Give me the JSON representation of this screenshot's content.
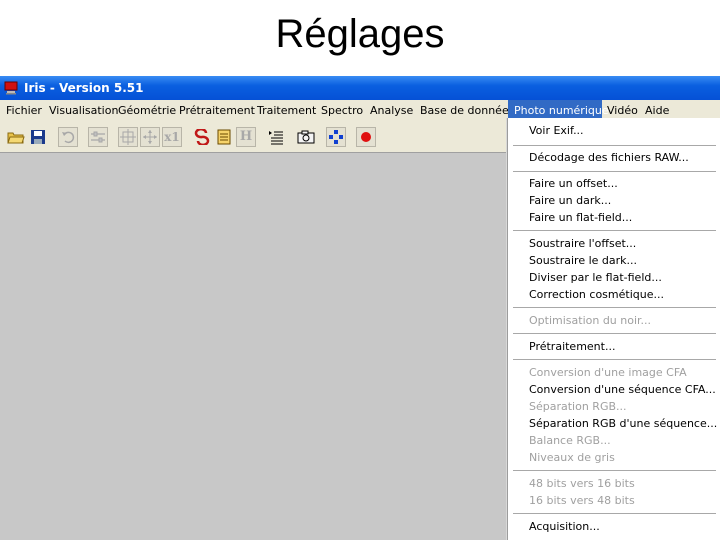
{
  "slide": {
    "title": "Réglages"
  },
  "window": {
    "title": "Iris - Version 5.51",
    "menu": [
      {
        "label": "Fichier",
        "active": false
      },
      {
        "label": "Visualisation",
        "active": false
      },
      {
        "label": "Géométrie",
        "active": false
      },
      {
        "label": "Prétraitement",
        "active": false
      },
      {
        "label": "Traitement",
        "active": false
      },
      {
        "label": "Spectro",
        "active": false
      },
      {
        "label": "Analyse",
        "active": false
      },
      {
        "label": "Base de données",
        "active": false
      },
      {
        "label": "Photo numérique",
        "active": true
      },
      {
        "label": "Vidéo",
        "active": false
      },
      {
        "label": "Aide",
        "active": false
      }
    ],
    "toolbar": {
      "x1_label": "x1",
      "h_label": "H",
      "buttons": [
        {
          "icon": "open-folder-icon",
          "enabled": true
        },
        {
          "icon": "save-disk-icon",
          "enabled": true
        },
        {
          "icon": "undo-icon",
          "enabled": false
        },
        {
          "icon": "sliders-icon",
          "enabled": false
        },
        {
          "icon": "select-crosshair-icon",
          "enabled": false
        },
        {
          "icon": "move-arrows-icon",
          "enabled": false
        },
        {
          "icon": "zoom-x1-icon",
          "enabled": false
        },
        {
          "icon": "red-s-icon",
          "enabled": true
        },
        {
          "icon": "notepad-icon",
          "enabled": true
        },
        {
          "icon": "header-h-icon",
          "enabled": false
        },
        {
          "icon": "list-icon",
          "enabled": true
        },
        {
          "icon": "camera-icon",
          "enabled": true
        },
        {
          "icon": "blue-diamond-icon",
          "enabled": true
        },
        {
          "icon": "red-record-icon",
          "enabled": true
        }
      ]
    },
    "photo_menu": {
      "voir_exif": "Voir Exif...",
      "decodage_raw": "Décodage des fichiers RAW...",
      "faire_offset": "Faire un offset...",
      "faire_dark": "Faire un dark...",
      "faire_flat": "Faire un flat-field...",
      "soustraire_offset": "Soustraire l'offset...",
      "soustraire_dark": "Soustraire le dark...",
      "diviser_flat": "Diviser par le flat-field...",
      "correction_cosmetique": "Correction cosmétique...",
      "optimisation_noir": "Optimisation du noir...",
      "pretraitement": "Prétraitement...",
      "conversion_cfa": "Conversion d'une image CFA",
      "conversion_sequence_cfa": "Conversion d'une séquence CFA...",
      "separation_rgb": "Séparation RGB...",
      "separation_rgb_sequence": "Séparation RGB d'une séquence...",
      "balance_rgb": "Balance RGB...",
      "niveaux_gris": "Niveaux de gris",
      "bits_48_16": "48 bits vers 16 bits",
      "bits_16_48": "16 bits vers 48 bits",
      "acquisition": "Acquisition..."
    }
  },
  "colors": {
    "titlebar": "#0a5fe0",
    "menubar": "#ece9d8",
    "menu_highlight": "#316ac5",
    "workspace": "#c8c8c8",
    "disabled_text": "#a0a0a0"
  }
}
